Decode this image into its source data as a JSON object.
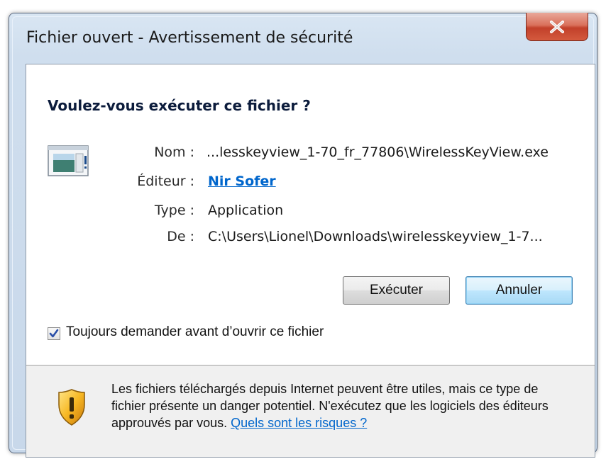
{
  "window": {
    "title": "Fichier ouvert - Avertissement de sécurité",
    "close_label": "X"
  },
  "dialog": {
    "heading": "Voulez-vous exécuter ce fichier ?",
    "fields": {
      "name_label": "Nom :",
      "name_value": "...lesskeyview_1-70_fr_77806\\WirelessKeyView.exe",
      "publisher_label": "Éditeur :",
      "publisher_value": "Nir Sofer",
      "type_label": "Type :",
      "type_value": "Application",
      "from_label": "De :",
      "from_value": "C:\\Users\\Lionel\\Downloads\\wirelesskeyview_1-7..."
    },
    "buttons": {
      "run": "Exécuter",
      "cancel": "Annuler"
    },
    "checkbox": {
      "label": "Toujours demander avant d’ouvrir ce fichier",
      "checked": true
    }
  },
  "footer": {
    "warning_text": "Les fichiers téléchargés depuis Internet peuvent être utiles, mais ce type de fichier présente un danger potentiel. N'exécutez que les logiciels des éditeurs approuvés par vous.",
    "risk_link": "Quels sont les risques ?"
  },
  "icons": {
    "app": "application-icon",
    "shield": "security-shield-icon",
    "close": "close-icon",
    "check": "checkmark-icon"
  },
  "colors": {
    "link": "#0066cc",
    "close_button": "#c2402a",
    "footer_bg": "#f0f0f0"
  }
}
